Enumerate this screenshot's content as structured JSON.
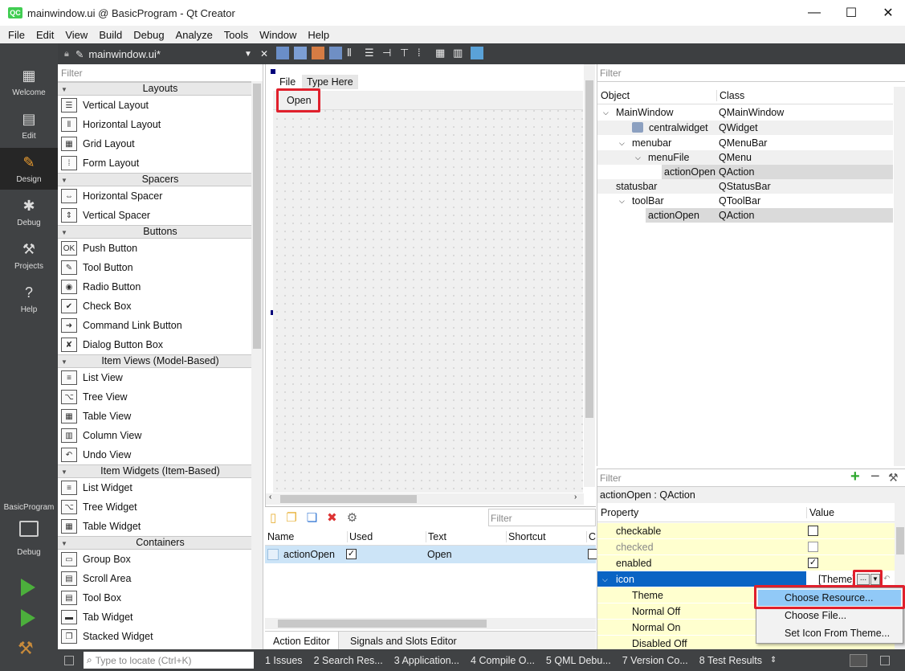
{
  "window": {
    "title": "mainwindow.ui @ BasicProgram - Qt Creator",
    "icon": "QC"
  },
  "menubar": [
    "File",
    "Edit",
    "View",
    "Build",
    "Debug",
    "Analyze",
    "Tools",
    "Window",
    "Help"
  ],
  "modes": [
    {
      "label": "Welcome",
      "icon": "grid-icon"
    },
    {
      "label": "Edit",
      "icon": "document-icon"
    },
    {
      "label": "Design",
      "icon": "pencil-icon"
    },
    {
      "label": "Debug",
      "icon": "bug-icon"
    },
    {
      "label": "Projects",
      "icon": "wrench-icon"
    },
    {
      "label": "Help",
      "icon": "help-icon"
    }
  ],
  "kit": {
    "project": "BasicProgram",
    "mode": "Debug"
  },
  "editor": {
    "file": "mainwindow.ui*"
  },
  "widgetbox": {
    "filter_placeholder": "Filter",
    "categories": [
      {
        "name": "Layouts",
        "items": [
          "Vertical Layout",
          "Horizontal Layout",
          "Grid Layout",
          "Form Layout"
        ]
      },
      {
        "name": "Spacers",
        "items": [
          "Horizontal Spacer",
          "Vertical Spacer"
        ]
      },
      {
        "name": "Buttons",
        "items": [
          "Push Button",
          "Tool Button",
          "Radio Button",
          "Check Box",
          "Command Link Button",
          "Dialog Button Box"
        ]
      },
      {
        "name": "Item Views (Model-Based)",
        "items": [
          "List View",
          "Tree View",
          "Table View",
          "Column View",
          "Undo View"
        ]
      },
      {
        "name": "Item Widgets (Item-Based)",
        "items": [
          "List Widget",
          "Tree Widget",
          "Table Widget"
        ]
      },
      {
        "name": "Containers",
        "items": [
          "Group Box",
          "Scroll Area",
          "Tool Box",
          "Tab Widget",
          "Stacked Widget"
        ]
      }
    ]
  },
  "form": {
    "menu_file": "File",
    "menu_type_here": "Type Here",
    "toolbar_action": "Open"
  },
  "action_editor": {
    "filter_placeholder": "Filter",
    "columns": [
      "Name",
      "Used",
      "Text",
      "Shortcut",
      "C"
    ],
    "row": {
      "name": "actionOpen",
      "used": true,
      "text": "Open"
    },
    "tabs": [
      "Action Editor",
      "Signals and Slots Editor"
    ]
  },
  "object_inspector": {
    "filter_placeholder": "Filter",
    "columns": [
      "Object",
      "Class"
    ],
    "rows": [
      {
        "object": "MainWindow",
        "class": "QMainWindow"
      },
      {
        "object": "centralwidget",
        "class": "QWidget"
      },
      {
        "object": "menubar",
        "class": "QMenuBar"
      },
      {
        "object": "menuFile",
        "class": "QMenu"
      },
      {
        "object": "actionOpen",
        "class": "QAction"
      },
      {
        "object": "statusbar",
        "class": "QStatusBar"
      },
      {
        "object": "toolBar",
        "class": "QToolBar"
      },
      {
        "object": "actionOpen",
        "class": "QAction"
      }
    ]
  },
  "property_editor": {
    "filter_placeholder": "Filter",
    "context": "actionOpen : QAction",
    "columns": [
      "Property",
      "Value"
    ],
    "rows": [
      {
        "name": "checkable",
        "checked": false
      },
      {
        "name": "checked",
        "checked": false
      },
      {
        "name": "enabled",
        "checked": true
      },
      {
        "name": "icon",
        "value": "[Theme]",
        "dots": "..."
      },
      {
        "name": "Theme"
      },
      {
        "name": "Normal Off"
      },
      {
        "name": "Normal On"
      },
      {
        "name": "Disabled Off"
      }
    ],
    "popup": [
      "Choose Resource...",
      "Choose File...",
      "Set Icon From Theme..."
    ]
  },
  "statusbar": {
    "locate_placeholder": "Type to locate (Ctrl+K)",
    "panes": [
      "1  Issues",
      "2  Search Res...",
      "3  Application...",
      "4  Compile O...",
      "5  QML Debu...",
      "7  Version Co...",
      "8  Test Results"
    ]
  }
}
